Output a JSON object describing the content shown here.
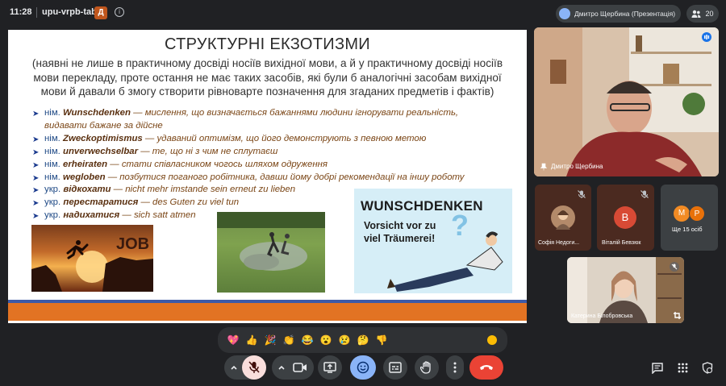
{
  "topbar": {
    "time": "11:28",
    "meeting_code": "upu-vrpb-tab",
    "badge": "Д",
    "info_icon": "info-icon",
    "presenter_label": "Дмитро Щербина (Презентація)",
    "participant_count": "20"
  },
  "slide": {
    "title": "СТРУКТУРНІ ЕКЗОТИЗМИ",
    "subtitle": "(наявні не лише в практичному досвіді носіїв вихідної мови, а й у практичному досвіді носіїв мови перекладу, проте остання не має таких засобів, які були б аналогічні засобам вихідної мови й давали б змогу створити рівноварте позначення для згаданих предметів і фактів)",
    "items": [
      {
        "lang": "нім.",
        "term": "Wunschdenken",
        "rest": " — мислення, що визначається бажаннями людини ігнорувати реальність,",
        "rest2": "видавати бажане за дійсне"
      },
      {
        "lang": "нім.",
        "term": "Zweckoptimismus",
        "rest": " — удаваний оптимізм, що його демонструють з певною метою"
      },
      {
        "lang": "нім.",
        "term": "unverwechselbar",
        "rest": " — те, що ні з чим не сплутаєш"
      },
      {
        "lang": "нім.",
        "term": "erheiraten",
        "rest": " — стати співласником чогось шляхом одруження"
      },
      {
        "lang": "нім.",
        "term": "wegloben",
        "rest": " — позбутися поганого робітника, давши йому добрі рекомендації на іншу роботу"
      },
      {
        "lang": "укр.",
        "term": "відкохати",
        "rest": " — nicht mehr imstande sein erneut zu lieben"
      },
      {
        "lang": "укр.",
        "term": "перестаратися",
        "rest": " — des Guten zu viel tun"
      },
      {
        "lang": "укр.",
        "term": "надихатися",
        "rest": " — sich satt atmen"
      }
    ],
    "image1_text": "JOB",
    "image3_title": "WUNSCHDENKEN",
    "image3_text": "Vorsicht vor zu viel Träumerei!"
  },
  "participants": {
    "main": {
      "name": "Дмитро Щербина"
    },
    "sofia": {
      "name": "Софія Недоги..."
    },
    "vitaliy": {
      "name": "Віталій Бевзюк",
      "initial": "В"
    },
    "more": {
      "label": "Ще 15 осіб",
      "initials": [
        "M",
        "P"
      ]
    },
    "kateryna": {
      "name": "Катерина Білобровська"
    }
  },
  "reactions": [
    "💖",
    "👍",
    "🎉",
    "👏",
    "😂",
    "😮",
    "😢",
    "🤔",
    "👎"
  ],
  "colors": {
    "bg": "#202124",
    "end_call": "#ea4335",
    "active_blue": "#8ab4f8",
    "slide_bar_orange": "#e27323",
    "slide_bar_blue": "#3d5aa8",
    "vitaliy_avatar": "#d84a35",
    "more_m": "#f28b24",
    "more_p": "#e8710a"
  }
}
